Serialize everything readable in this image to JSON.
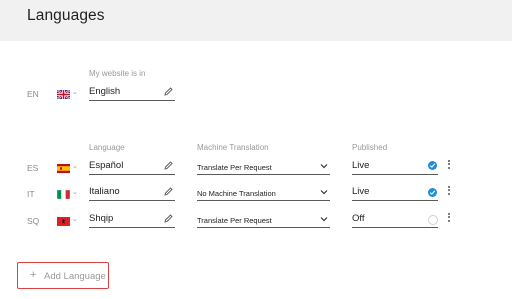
{
  "page": {
    "title": "Languages"
  },
  "default_language": {
    "label": "My website is in",
    "code": "EN",
    "flag": "uk-flag-icon",
    "value": "English"
  },
  "table": {
    "headers": {
      "language": "Language",
      "machine_translation": "Machine Translation",
      "published": "Published"
    },
    "rows": [
      {
        "code": "ES",
        "flag": "spain-flag-icon",
        "language": "Español",
        "machine_translation": "Translate Per Request",
        "published": "Live",
        "published_checked": true
      },
      {
        "code": "IT",
        "flag": "italy-flag-icon",
        "language": "Italiano",
        "machine_translation": "No Machine Translation",
        "published": "Live",
        "published_checked": true
      },
      {
        "code": "SQ",
        "flag": "albania-flag-icon",
        "language": "Shqip",
        "machine_translation": "Translate Per Request",
        "published": "Off",
        "published_checked": false
      }
    ]
  },
  "actions": {
    "add_language_label": "Add Language"
  },
  "colors": {
    "accent": "#1e8fd6",
    "highlight_border": "#d94040",
    "header_bg": "#f1f1f1"
  }
}
